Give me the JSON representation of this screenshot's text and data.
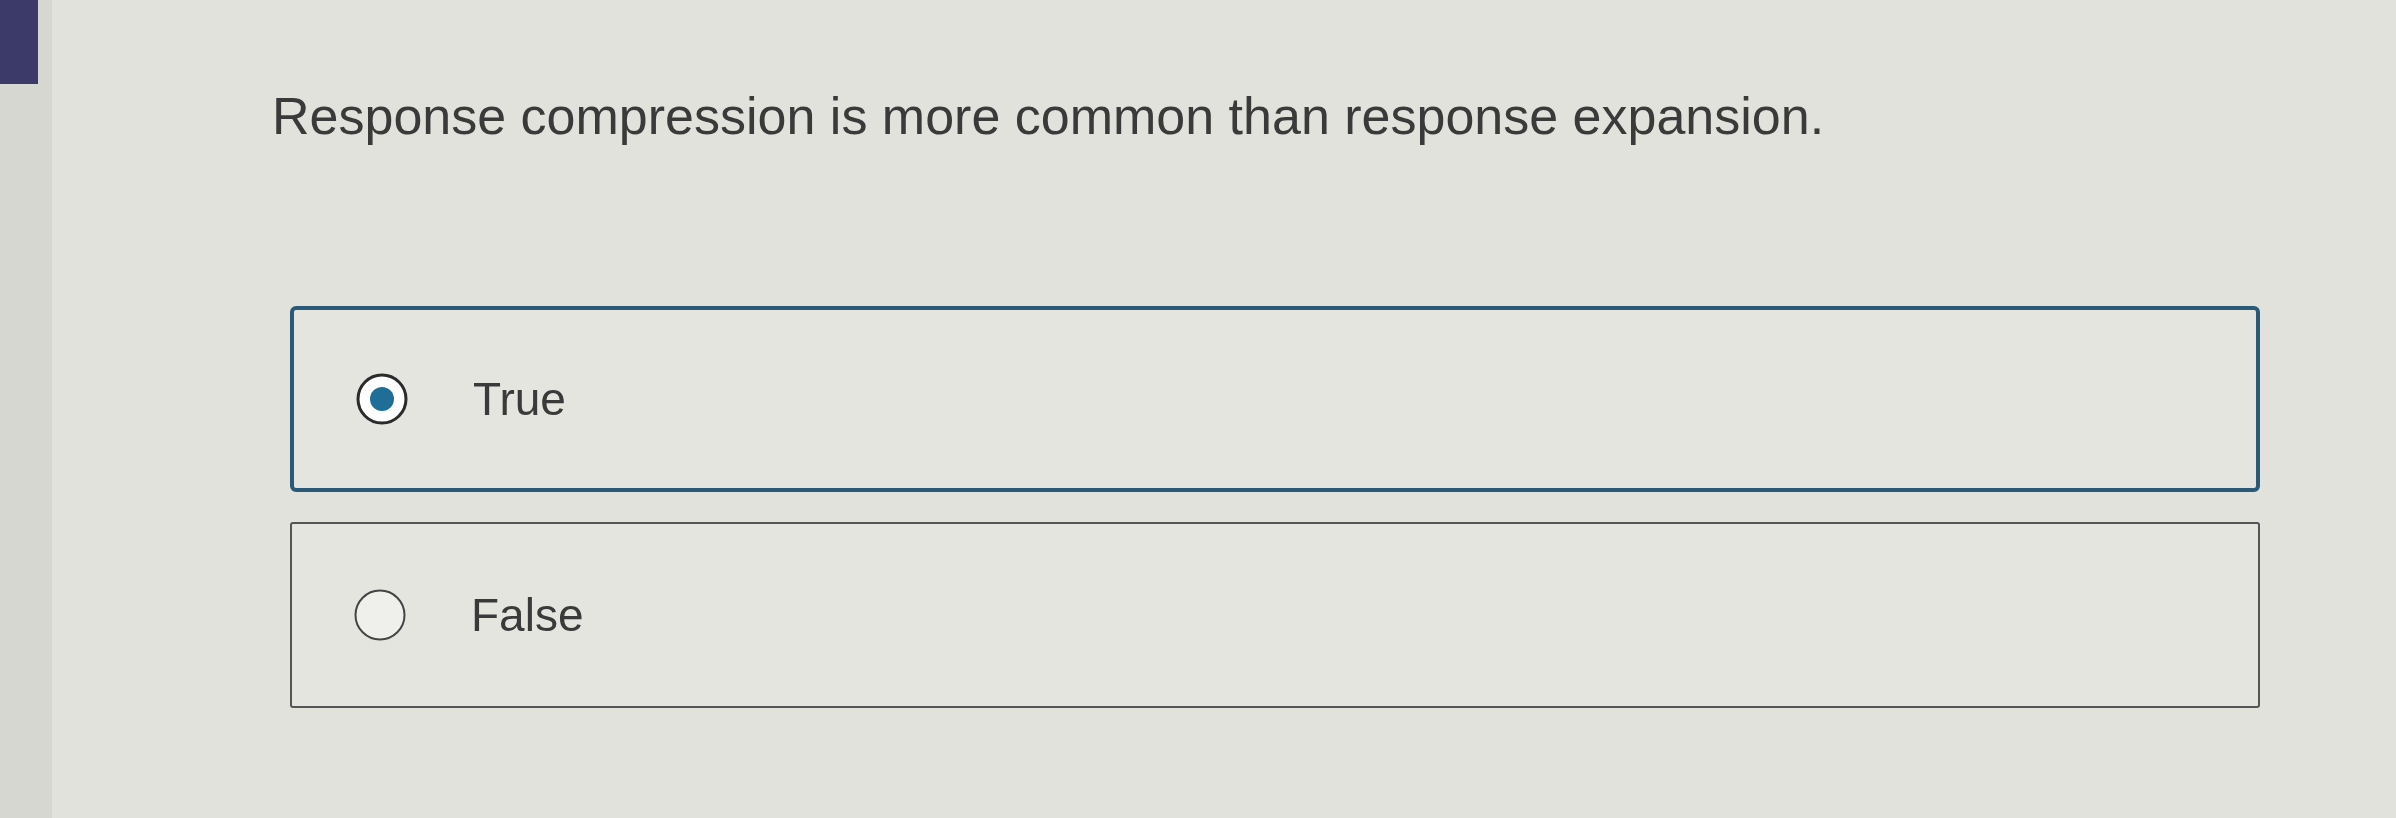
{
  "question": {
    "text": "Response compression is more common than response expansion."
  },
  "options": [
    {
      "label": "True",
      "selected": true
    },
    {
      "label": "False",
      "selected": false
    }
  ]
}
